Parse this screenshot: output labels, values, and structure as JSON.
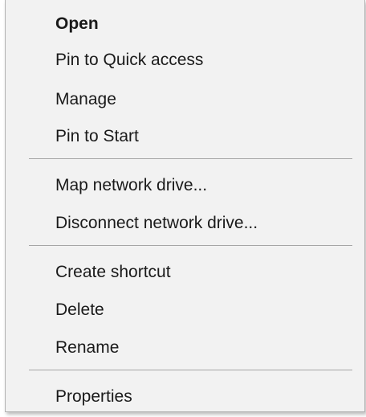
{
  "context_menu": {
    "items": [
      {
        "label": "Open"
      },
      {
        "label": "Pin to Quick access"
      },
      {
        "label": "Manage"
      },
      {
        "label": "Pin to Start"
      },
      {
        "label": "Map network drive..."
      },
      {
        "label": "Disconnect network drive..."
      },
      {
        "label": "Create shortcut"
      },
      {
        "label": "Delete"
      },
      {
        "label": "Rename"
      },
      {
        "label": "Properties"
      }
    ]
  }
}
